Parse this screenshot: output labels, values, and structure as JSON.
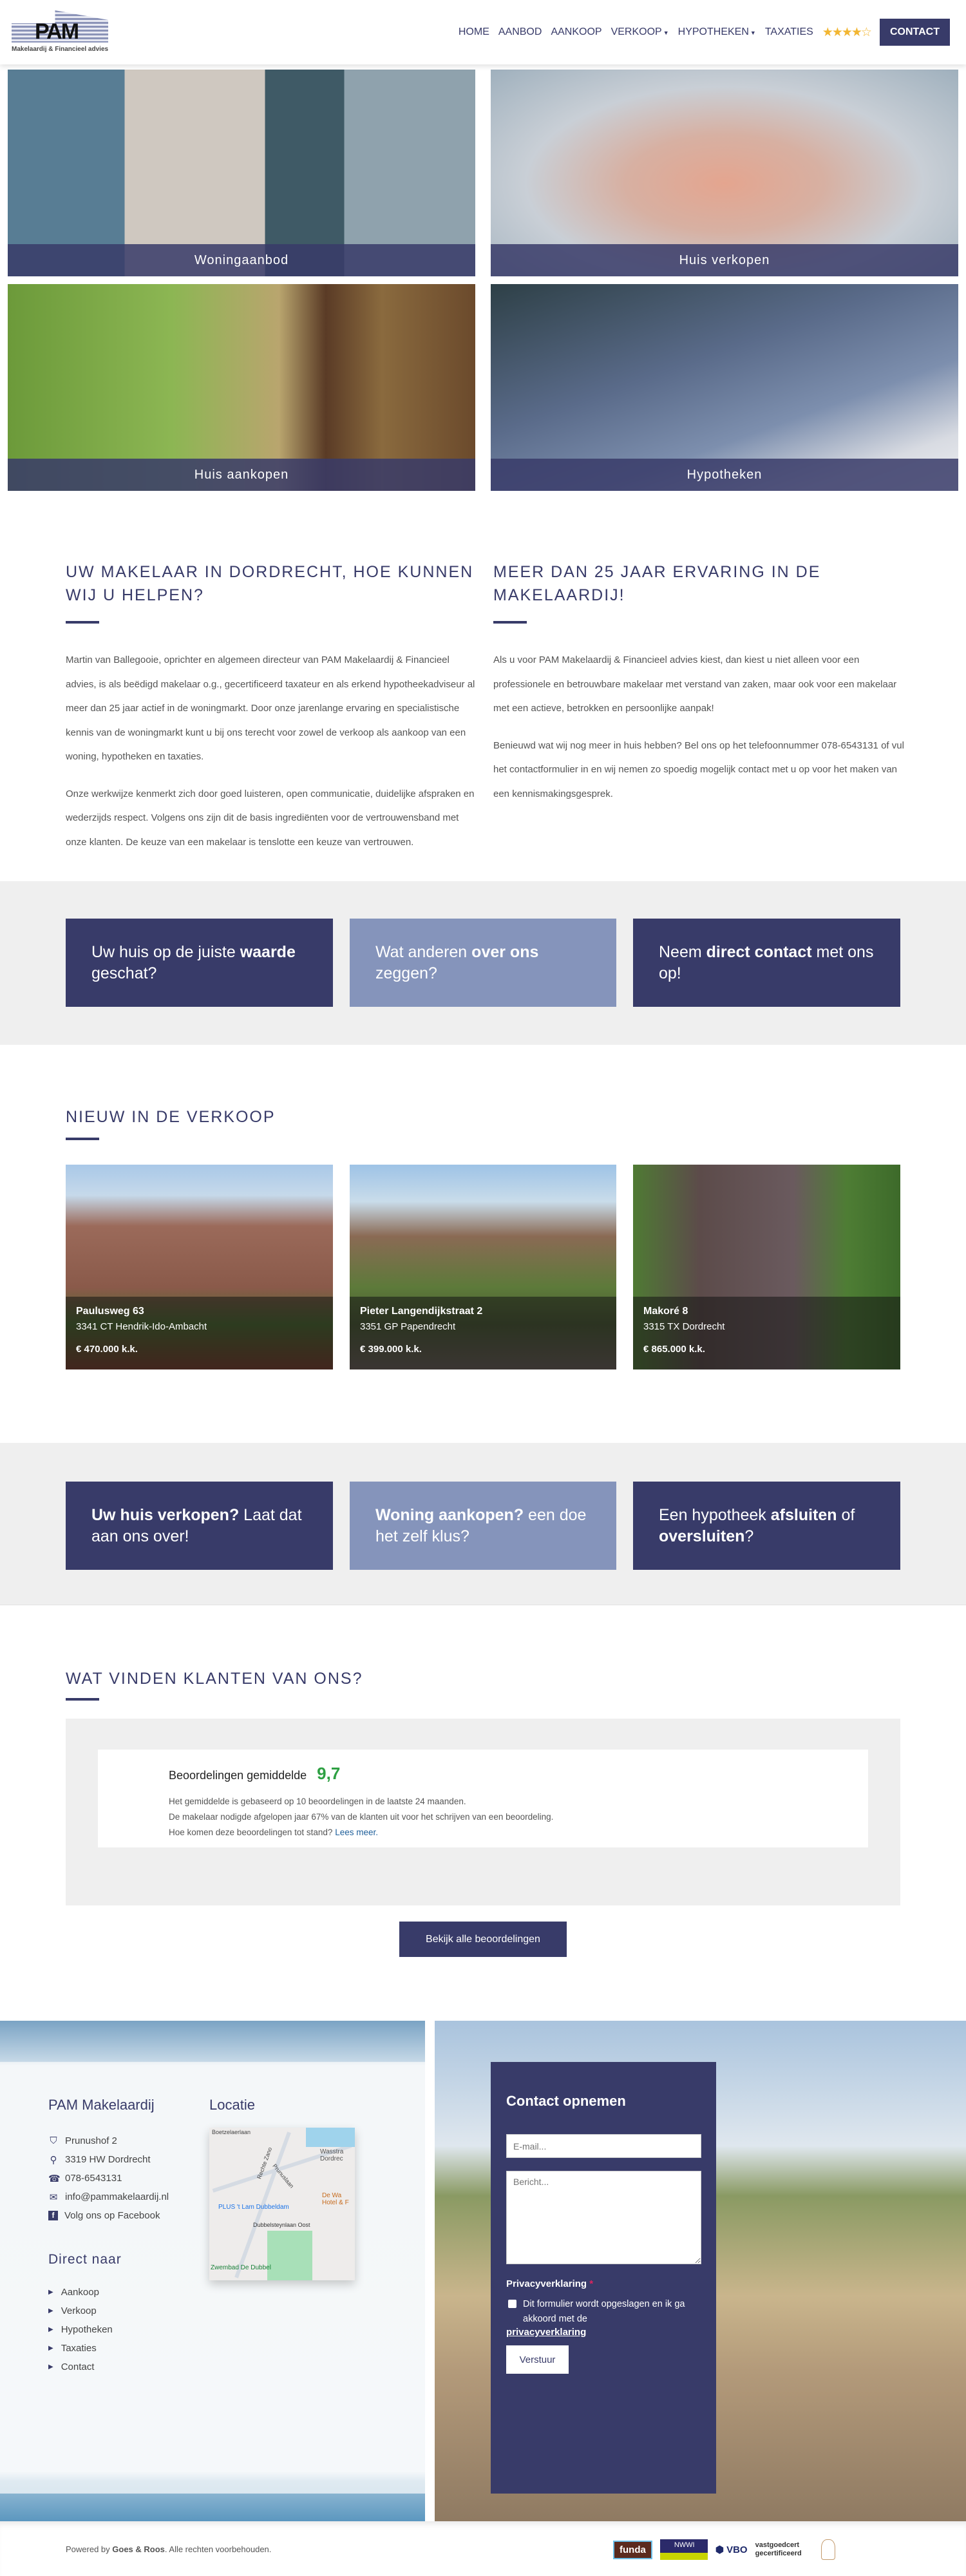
{
  "header": {
    "logo_text": "PAM",
    "logo_subtitle": "Makelaardij & Financieel advies",
    "nav": [
      {
        "label": "HOME"
      },
      {
        "label": "AANBOD"
      },
      {
        "label": "AANKOOP"
      },
      {
        "label": "VERKOOP",
        "dropdown": true
      },
      {
        "label": "HYPOTHEKEN",
        "dropdown": true
      },
      {
        "label": "TAXATIES"
      }
    ],
    "rating_stars": 4.5,
    "stars_glyph": "★★★★☆",
    "contact_label": "CONTACT"
  },
  "tiles": [
    {
      "label": "Woningaanbod"
    },
    {
      "label": "Huis verkopen"
    },
    {
      "label": "Huis aankopen"
    },
    {
      "label": "Hypotheken"
    }
  ],
  "intro": {
    "left": {
      "title": "UW MAKELAAR IN DORDRECHT, HOE KUNNEN WIJ U HELPEN?",
      "paragraphs": [
        "Martin van Ballegooie, oprichter en algemeen directeur van PAM Makelaardij & Financieel advies, is als beëdigd makelaar o.g., gecertificeerd taxateur en als erkend hypotheekadviseur al meer dan 25 jaar actief in de woningmarkt. Door onze jarenlange ervaring en specialistische kennis van de woningmarkt kunt u bij ons terecht voor zowel de verkoop als aankoop van een woning, hypotheken en taxaties.",
        "Onze werkwijze kenmerkt zich door goed luisteren, open communicatie, duidelijke afspraken en wederzijds respect. Volgens ons zijn dit de basis ingrediënten voor de vertrouwensband met onze klanten. De keuze van een makelaar is tenslotte een keuze van vertrouwen."
      ]
    },
    "right": {
      "title": "MEER DAN 25 JAAR ERVARING IN DE MAKELAARDIJ!",
      "paragraphs": [
        "Als u voor PAM Makelaardij & Financieel advies kiest, dan kiest u niet alleen voor een professionele en betrouwbare makelaar met verstand van zaken, maar ook voor een makelaar met een actieve, betrokken en persoonlijke aanpak!",
        "Benieuwd wat wij nog meer in huis hebben? Bel ons op het telefoonnummer 078-6543131 of vul het contactformulier in en wij nemen zo spoedig mogelijk contact met u op voor het maken van een kennismakingsgesprek."
      ]
    }
  },
  "cta1": [
    {
      "a": "Uw huis op de juiste ",
      "b": "waarde",
      "c": " geschat?"
    },
    {
      "a": "Wat anderen ",
      "b": "over ons",
      "c": " zeggen?"
    },
    {
      "a": "Neem ",
      "b": "direct contact",
      "c": " met ons op!"
    }
  ],
  "listings": {
    "title": "NIEUW IN DE VERKOOP",
    "items": [
      {
        "street": "Paulusweg 63",
        "city": "3341 CT Hendrik-Ido-Ambacht",
        "price": "€ 470.000 k.k."
      },
      {
        "street": "Pieter Langendijkstraat 2",
        "city": "3351 GP Papendrecht",
        "price": "€ 399.000 k.k."
      },
      {
        "street": "Makoré 8",
        "city": "3315 TX Dordrecht",
        "price": "€ 865.000 k.k."
      }
    ]
  },
  "cta2": [
    {
      "b1": "Uw huis verkopen?",
      "a": " Laat dat aan ons over!"
    },
    {
      "b1": "Woning aankopen?",
      "a": " een doe het zelf klus?"
    },
    {
      "a": "Een hypotheek ",
      "b": "afsluiten",
      "c": " of ",
      "d": "oversluiten",
      "e": "?"
    }
  ],
  "reviews": {
    "title": "WAT VINDEN KLANTEN VAN ONS?",
    "avg_label": "Beoordelingen gemiddelde",
    "avg_value": "9,7",
    "lines": [
      "Het gemiddelde is gebaseerd op 10 beoordelingen in de laatste 24 maanden.",
      "De makelaar nodigde afgelopen jaar 67% van de klanten uit voor het schrijven van een beoordeling.",
      "Hoe komen deze beoordelingen tot stand? "
    ],
    "read_more": "Lees meer.",
    "button": "Bekijk alle beoordelingen"
  },
  "footer": {
    "company_title": "PAM Makelaardij",
    "address": "Prunushof 2",
    "postal": "3319 HW Dordrecht",
    "phone": "078-6543131",
    "email": "info@pammakelaardij.nl",
    "facebook": "Volg ons op Facebook",
    "location_title": "Locatie",
    "map_labels": [
      "Boetzelaerlaan",
      "Rechte Zano",
      "Prunuslaan",
      "Wasstra Dordrec",
      "PLUS 't Lam Dubbeldam",
      "De Wa Hotel & F",
      "Dubbelsteynlaan Oost",
      "Zwembad De Dubbel"
    ],
    "direct_title": "Direct naar",
    "direct_links": [
      "Aankoop",
      "Verkoop",
      "Hypotheken",
      "Taxaties",
      "Contact"
    ],
    "form": {
      "title": "Contact opnemen",
      "email_placeholder": "E-mail...",
      "message_placeholder": "Bericht...",
      "privacy_label": "Privacyverklaring",
      "required": "*",
      "consent": "Dit formulier wordt opgeslagen en ik ga akkoord met de ",
      "consent_link": "privacyverklaring",
      "submit": "Verstuur"
    }
  },
  "bottom": {
    "powered_a": "Powered by ",
    "powered_b": "Goes & Roos",
    "powered_c": ". Alle rechten voorbehouden.",
    "logos": [
      "funda",
      "NWWI",
      "VBO",
      "vastgoedcert gecertificeerd",
      "tophuis"
    ]
  },
  "colors": {
    "primary": "#383b69",
    "secondary": "#8594bb",
    "band": "#efefef",
    "score": "#2ea043",
    "stars": "#f2b632"
  }
}
